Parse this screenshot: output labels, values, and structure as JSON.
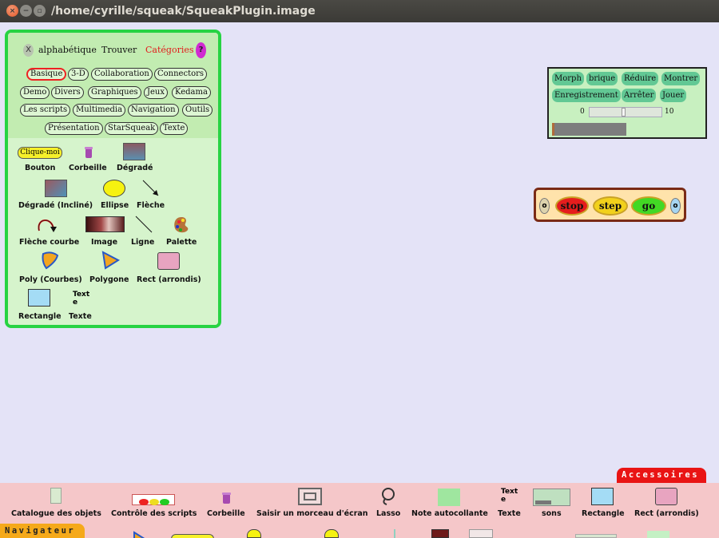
{
  "window": {
    "title": "/home/cyrille/squeak/SqueakPlugin.image"
  },
  "flap": {
    "header": {
      "close": "X",
      "alpha": "alphabétique",
      "find": "Trouver",
      "categories": "Catégories",
      "help": "?"
    },
    "categories": [
      "Basique",
      "3-D",
      "Collaboration",
      "Connectors",
      "Demo",
      "Divers",
      "Graphiques",
      "Jeux",
      "Kedama",
      "Les scripts",
      "Multimedia",
      "Navigation",
      "Outils",
      "Présentation",
      "StarSqueak",
      "Texte"
    ],
    "selected_category": "Basique",
    "button_sample": "Clique-moi",
    "text_sample": "Text e",
    "items": [
      "Bouton",
      "Corbeille",
      "Dégradé",
      "Dégradé (Incliné)",
      "Ellipse",
      "Flèche",
      "Flèche courbe",
      "Image",
      "Ligne",
      "Palette",
      "Poly (Courbes)",
      "Polygone",
      "Rect (arrondis)",
      "Rectangle",
      "Texte"
    ]
  },
  "recorder": {
    "buttons": [
      "Morph",
      "brique",
      "Réduire",
      "Montrer",
      "Enregistrement",
      "Arrêter",
      "Jouer"
    ],
    "min": "0",
    "max": "10"
  },
  "stopstepgo": {
    "stop": "stop",
    "step": "step",
    "go": "go"
  },
  "bottom": {
    "items": [
      "Catalogue des objets",
      "Contrôle des scripts",
      "Corbeille",
      "Saisir un morceau d'écran",
      "Lasso",
      "Note autocollante",
      "Texte",
      "sons",
      "Rectangle",
      "Rect (arrondis)"
    ],
    "text_icon": "Text e",
    "tabs": {
      "accessoires": "Accessoires",
      "navigateur": "Navigateur"
    }
  },
  "colors": {
    "flap_border": "#27d343",
    "flap_bg": "#d4f2c8",
    "desktop": "#e4e3f7",
    "bottom_bar": "#f5c7c9",
    "tab_red": "#e91414",
    "tab_orange": "#f5a91a"
  }
}
